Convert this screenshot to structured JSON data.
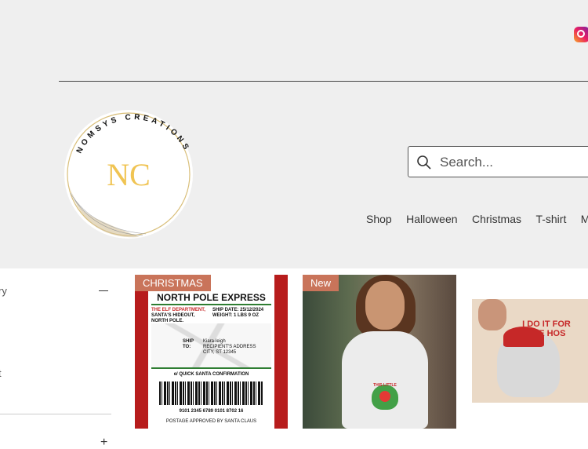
{
  "header": {
    "brand": {
      "logo_ring_text": "NOMSYS CREATIONS",
      "monogram": "NC",
      "accent_color": "#f0c453"
    },
    "social": {
      "icon": "instagram-icon"
    },
    "search": {
      "placeholder": "Search...",
      "icon": "search-icon"
    },
    "nav": [
      "Shop",
      "Halloween",
      "Christmas",
      "T-shirt",
      "Mug"
    ]
  },
  "sidebar": {
    "section_label_fragment": "ry",
    "item_fragment": "t",
    "collapse_icon": "minus-icon",
    "expand_icon": "plus-icon"
  },
  "products": [
    {
      "badge": "CHRISTMAS",
      "image": {
        "title": "NORTH POLE EXPRESS",
        "from_line1": "THE ELF DEPARTMENT,",
        "from_line2": "SANTA'S HIDEOUT,",
        "from_line3": "NORTH POLE.",
        "ship_date": "SHIP DATE: 25/12/2024",
        "weight": "WEIGHT: 1 LBS 9 OZ",
        "ship_to_label": "SHIP TO:",
        "recipient_name": "Kiara-leigh",
        "recipient_address": "RECIPIENT'S ADDRESS",
        "recipient_city": "CITY, ST 12345",
        "confirmation": "e/ QUICK SANTA CONFIRMATION",
        "tracking": "9101 2345 6789 0101 8702 16",
        "footer": "POSTAGE APPROVED BY SANTA CLAUS"
      }
    },
    {
      "badge": "New",
      "image": {
        "print_text": "THIS LITTLE"
      }
    },
    {
      "badge": "",
      "image": {
        "print_text": "I DO IT FOR THE HOS"
      }
    }
  ]
}
